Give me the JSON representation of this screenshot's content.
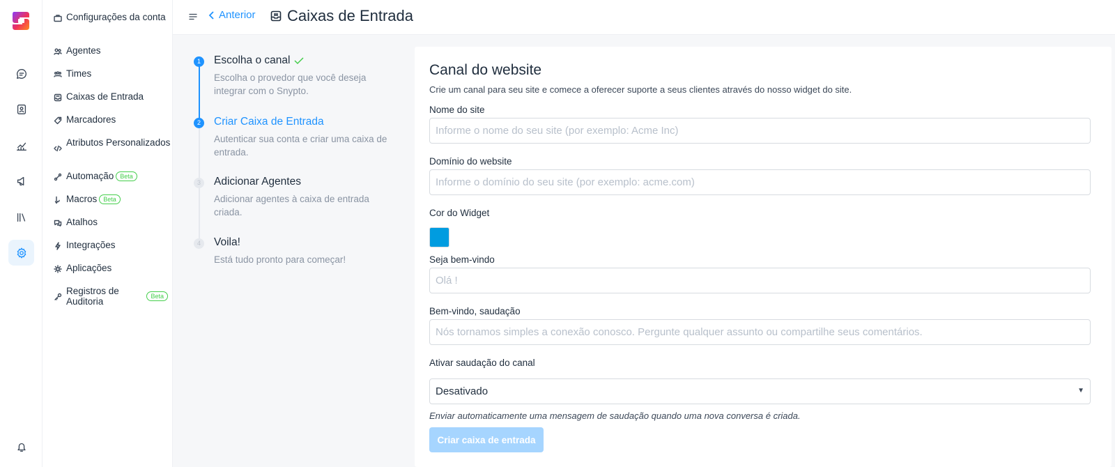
{
  "app": {
    "brand_color": "#1f93ff"
  },
  "rail": {
    "items": [
      {
        "icon": "conversations-icon"
      },
      {
        "icon": "contacts-icon"
      },
      {
        "icon": "reports-icon"
      },
      {
        "icon": "campaigns-icon"
      },
      {
        "icon": "library-icon"
      },
      {
        "icon": "settings-icon",
        "active": true
      },
      {
        "icon": "notifications-icon"
      }
    ]
  },
  "sidebar": {
    "items": [
      {
        "label": "Configurações da conta",
        "icon": "briefcase-icon"
      },
      {
        "label": "Agentes",
        "icon": "people-icon"
      },
      {
        "label": "Times",
        "icon": "team-icon"
      },
      {
        "label": "Caixas de Entrada",
        "icon": "inbox-icon"
      },
      {
        "label": "Marcadores",
        "icon": "tag-icon"
      },
      {
        "label": "Atributos Personalizados",
        "icon": "code-icon"
      },
      {
        "label": "Automação",
        "icon": "automation-icon",
        "badge": "Beta"
      },
      {
        "label": "Macros",
        "icon": "macros-icon",
        "badge": "Beta"
      },
      {
        "label": "Atalhos",
        "icon": "chat-icon"
      },
      {
        "label": "Integrações",
        "icon": "flash-icon"
      },
      {
        "label": "Aplicações",
        "icon": "apps-icon"
      },
      {
        "label": "Registros de Auditoria",
        "icon": "key-icon",
        "badge": "Beta"
      }
    ]
  },
  "header": {
    "back_label": "Anterior",
    "title": "Caixas de Entrada"
  },
  "wizard": {
    "steps": [
      {
        "number": "1",
        "title": "Escolha o canal",
        "description": "Escolha o provedor que você deseja integrar com o Snypto.",
        "state": "done"
      },
      {
        "number": "2",
        "title": "Criar Caixa de Entrada",
        "description": "Autenticar sua conta e criar uma caixa de entrada.",
        "state": "current"
      },
      {
        "number": "3",
        "title": "Adicionar Agentes",
        "description": "Adicionar agentes à caixa de entrada criada.",
        "state": "todo"
      },
      {
        "number": "4",
        "title": "Voila!",
        "description": "Está tudo pronto para começar!",
        "state": "todo"
      }
    ]
  },
  "form": {
    "title": "Canal do website",
    "description": "Crie um canal para seu site e comece a oferecer suporte a seus clientes através do nosso widget do site.",
    "site_name": {
      "label": "Nome do site",
      "value": "",
      "placeholder": "Informe o nome do seu site (por exemplo: Acme Inc)"
    },
    "domain": {
      "label": "Domínio do website",
      "value": "",
      "placeholder": "Informe o domínio do seu site (por exemplo: acme.com)"
    },
    "widget_color": {
      "label": "Cor do Widget",
      "value": "#009CE0"
    },
    "welcome_title": {
      "label": "Seja bem-vindo",
      "value": "",
      "placeholder": "Olá !"
    },
    "welcome_tagline": {
      "label": "Bem-vindo, saudação",
      "value": "",
      "placeholder": "Nós tornamos simples a conexão conosco. Pergunte qualquer assunto ou compartilhe seus comentários."
    },
    "greeting": {
      "label": "Ativar saudação do canal",
      "selected": "Desativado",
      "help": "Enviar automaticamente uma mensagem de saudação quando uma nova conversa é criada."
    },
    "submit_label": "Criar caixa de entrada"
  }
}
